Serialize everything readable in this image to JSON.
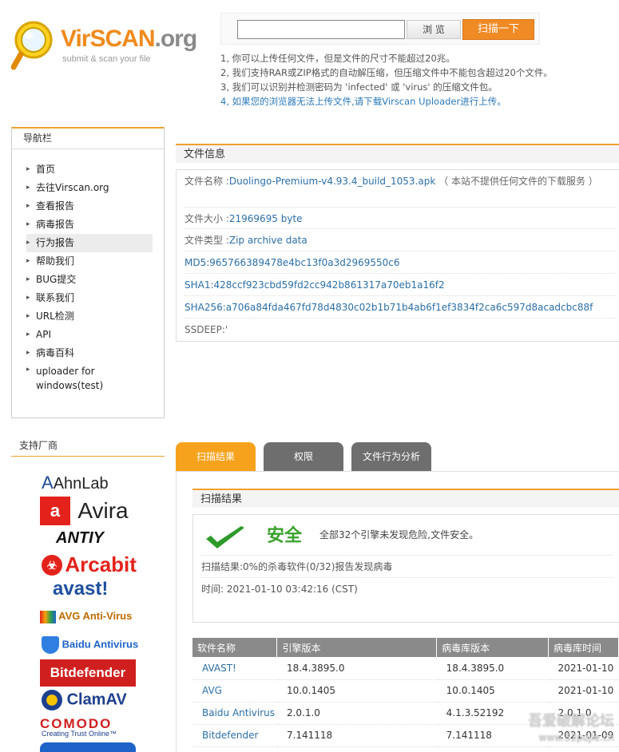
{
  "header": {
    "brand_vir": "VirSCAN",
    "brand_org": ".org",
    "tagline": "submit & scan your file",
    "browse_label": "浏 览",
    "scan_label": "扫描一下",
    "file_value": ""
  },
  "notes": [
    "1, 你可以上传任何文件，但是文件的尺寸不能超过20兆。",
    "2, 我们支持RAR或ZIP格式的自动解压缩，但压缩文件中不能包含超过20个文件。",
    "3, 我们可以识别并检测密码为 'infected' 或 'virus' 的压缩文件包。",
    "4, 如果您的浏览器无法上传文件,请下载Virscan Uploader进行上传。"
  ],
  "nav": {
    "title": "导航栏",
    "items": [
      "首页",
      "去往Virscan.org",
      "查看报告",
      "病毒报告",
      "行为报告",
      "帮助我们",
      "BUG提交",
      "联系我们",
      "URL检测",
      "API",
      "病毒百科"
    ],
    "last_item_1": "uploader for",
    "last_item_2": "windows(test)"
  },
  "vendors": {
    "title": "支持厂商",
    "list": [
      "AhnLab",
      "Avira",
      "ANTIY",
      "Arcabit",
      "avast!",
      "AVG Anti-Virus",
      "Baidu Antivirus",
      "Bitdefender",
      "ClamAV",
      "COMODO",
      "Creating Trust Online™"
    ]
  },
  "file_info": {
    "title": "文件信息",
    "name_label": "文件名称 :",
    "name_value": "Duolingo-Premium-v4.93.4_build_1053.apk",
    "name_note": "（ 本站不提供任何文件的下载服务 ）",
    "size_label": "文件大小 :",
    "size_value": "21969695 byte",
    "type_label": "文件类型 :",
    "type_value": "Zip archive data",
    "md5_label": "MD5:",
    "md5_value": "965766389478e4bc13f0a3d2969550c6",
    "sha1_label": "SHA1:",
    "sha1_value": "428ccf923cbd59fd2cc942b861317a70eb1a16f2",
    "sha256_label": "SHA256:",
    "sha256_value": "a706a84fda467fd78d4830c02b1b71b4ab6f1ef3834f2ca6c597d8acadcbc88f",
    "ssdeep_label": "SSDEEP:",
    "ssdeep_value": "'"
  },
  "tabs": [
    "扫描结果",
    "权限",
    "文件行为分析"
  ],
  "result": {
    "title": "扫描结果",
    "status": "安全",
    "summary": "全部32个引擎未发现危险,文件安全。",
    "ratio": "扫描结果:0%的杀毒软件(0/32)报告发现病毒",
    "time": "时间: 2021-01-10 03:42:16 (CST)"
  },
  "engines": {
    "headers": [
      "软件名称",
      "引擎版本",
      "病毒库版本",
      "病毒库时间"
    ],
    "rows": [
      [
        "AVAST!",
        "18.4.3895.0",
        "18.4.3895.0",
        "2021-01-10"
      ],
      [
        "AVG",
        "10.0.1405",
        "10.0.1405",
        "2021-01-10"
      ],
      [
        "Baidu Antivirus",
        "2.0.1.0",
        "4.1.3.52192",
        "2.0.1.0"
      ],
      [
        "Bitdefender",
        "7.141118",
        "7.141118",
        "2021-01-09"
      ]
    ]
  },
  "watermark": {
    "line1": "吾爱破解论坛",
    "line2": "www.52pojie.cn"
  },
  "colors": {
    "accent": "#f08a24",
    "safe": "#3aa12b",
    "link": "#2b6fa8"
  }
}
